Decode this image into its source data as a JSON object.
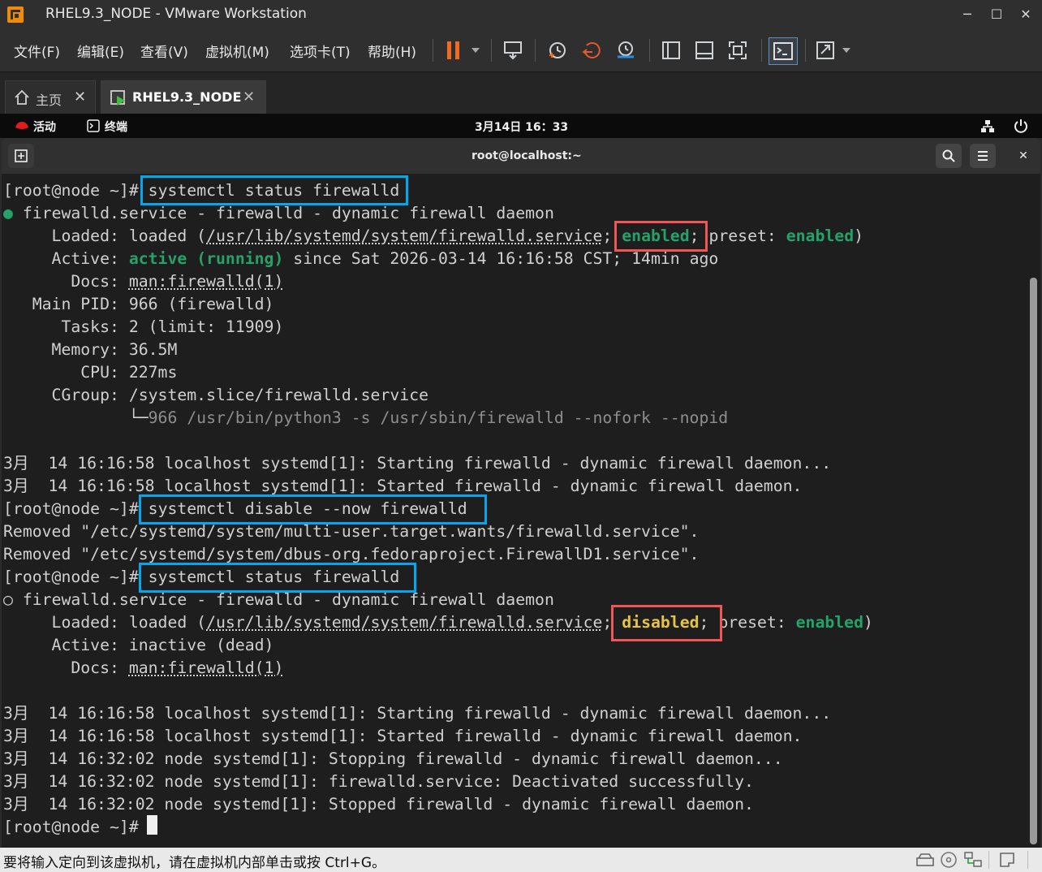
{
  "window": {
    "title": "RHEL9.3_NODE - VMware Workstation"
  },
  "menu": [
    "文件(F)",
    "编辑(E)",
    "查看(V)",
    "虚拟机(M)",
    "选项卡(T)",
    "帮助(H)"
  ],
  "tabs": [
    {
      "label": "主页"
    },
    {
      "label": "RHEL9.3_NODE"
    }
  ],
  "gnome": {
    "activities": "活动",
    "terminal_app": "终端",
    "clock": "3月14日 16：33"
  },
  "terminal": {
    "title": "root@localhost:~"
  },
  "term": {
    "prompt": "[root@node ~]#",
    "cmd1": "systemctl status firewalld",
    "s1_head_dot": "●",
    "s1_head": "firewalld.service - firewalld - dynamic firewall daemon",
    "loaded_label": "     Loaded: loaded (",
    "loaded_path": "/usr/lib/systemd/system/firewalld.service",
    "semi": ";",
    "enabled": "enabled",
    "preset_text": " preset: ",
    "preset_value": "enabled",
    "close_paren": ")",
    "active_label": "     Active: ",
    "active_value": "active (running)",
    "active_rest": " since Sat 2026-03-14 16:16:58 CST; 14min ago",
    "docs_label": "       Docs: ",
    "docs_value": "man:firewalld(1)",
    "mainpid": "   Main PID: 966 (firewalld)",
    "tasks": "      Tasks: 2 (limit: 11909)",
    "memory": "     Memory: 36.5M",
    "cpu": "        CPU: 227ms",
    "cgroup": "     CGroup: /system.slice/firewalld.service",
    "cgroup_tree": "             └─",
    "cgroup_proc": "966 /usr/bin/python3 -s /usr/sbin/firewalld --nofork --nopid",
    "log1": "3月  14 16:16:58 localhost systemd[1]: Starting firewalld - dynamic firewall daemon...",
    "log2": "3月  14 16:16:58 localhost systemd[1]: Started firewalld - dynamic firewall daemon.",
    "cmd2": "systemctl disable --now firewalld",
    "removed1": "Removed \"/etc/systemd/system/multi-user.target.wants/firewalld.service\".",
    "removed2": "Removed \"/etc/systemd/system/dbus-org.fedoraproject.FirewallD1.service\".",
    "cmd3": "systemctl status firewalld",
    "s2_head_dot": "○",
    "s2_head": "firewalld.service - firewalld - dynamic firewall daemon",
    "disabled": "disabled",
    "active2": "     Active: inactive (dead)",
    "log3": "3月  14 16:16:58 localhost systemd[1]: Starting firewalld - dynamic firewall daemon...",
    "log4": "3月  14 16:16:58 localhost systemd[1]: Started firewalld - dynamic firewall daemon.",
    "log5": "3月  14 16:32:02 node systemd[1]: Stopping firewalld - dynamic firewall daemon...",
    "log6": "3月  14 16:32:02 node systemd[1]: firewalld.service: Deactivated successfully.",
    "log7": "3月  14 16:32:02 node systemd[1]: Stopped firewalld - dynamic firewall daemon."
  },
  "statusbar": {
    "hint": "要将输入定向到该虚拟机，请在虚拟机内部单击或按 Ctrl+G。"
  },
  "colors": {
    "highlight_command": "#00a8f0",
    "highlight_state": "#f05656",
    "enabled_text": "#26a269",
    "disabled_text": "#e5c34b"
  }
}
